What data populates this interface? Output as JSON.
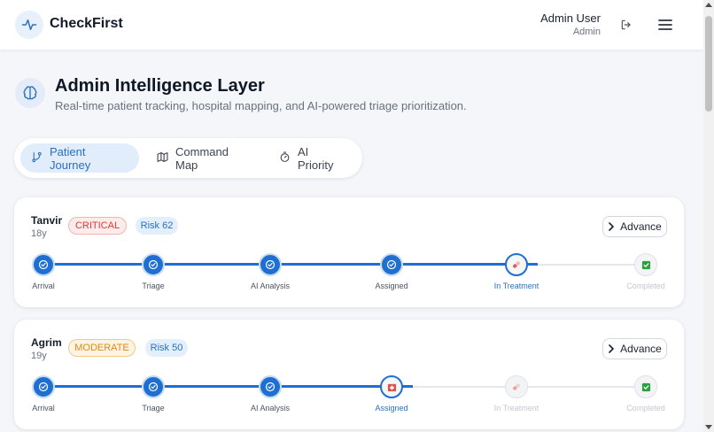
{
  "app": {
    "name": "CheckFirst"
  },
  "header": {
    "user_name": "Admin User",
    "user_role": "Admin"
  },
  "page": {
    "title": "Admin Intelligence Layer",
    "subtitle": "Real-time patient tracking, hospital mapping, and AI-powered triage prioritization."
  },
  "tabs": [
    {
      "label": "Patient Journey",
      "icon": "git-branch-icon",
      "active": true
    },
    {
      "label": "Command Map",
      "icon": "map-icon",
      "active": false
    },
    {
      "label": "AI Priority",
      "icon": "timer-icon",
      "active": false
    }
  ],
  "stages": [
    "Arrival",
    "Triage",
    "AI Analysis",
    "Assigned",
    "In Treatment",
    "Completed"
  ],
  "patients": [
    {
      "name": "Tanvir",
      "age": "18y",
      "severity": "CRITICAL",
      "risk": "Risk 62",
      "advance_label": "Advance",
      "current_stage": 4
    },
    {
      "name": "Agrim",
      "age": "19y",
      "severity": "MODERATE",
      "risk": "Risk 50",
      "advance_label": "Advance",
      "current_stage": 3
    }
  ],
  "colors": {
    "accent": "#1f6fd1",
    "critical": "#dc3a32",
    "moderate": "#dd8a14",
    "completed_icon": "#2ea043"
  }
}
